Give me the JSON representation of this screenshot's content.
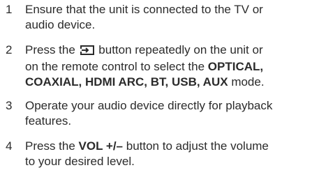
{
  "steps": [
    {
      "number": "1",
      "line1": "Ensure that the unit is connected to the TV or",
      "line2": "audio device."
    },
    {
      "number": "2",
      "line1_a": "Press the",
      "line1_b": "button repeatedly on the unit or",
      "line2": "on the remote control to select the",
      "modes_a": "OPTICAL,",
      "modes_b": "COAXIAL, HDMI ARC, BT, USB, AUX",
      "line3_end": "mode.",
      "icon": "source-input-icon"
    },
    {
      "number": "3",
      "line1": "Operate your audio device directly for playback",
      "line2": "features."
    },
    {
      "number": "4",
      "line1_a": "Press the",
      "line1_bold": "VOL +/–",
      "line1_b": "button to adjust the volume",
      "line2": "to your desired level."
    }
  ]
}
